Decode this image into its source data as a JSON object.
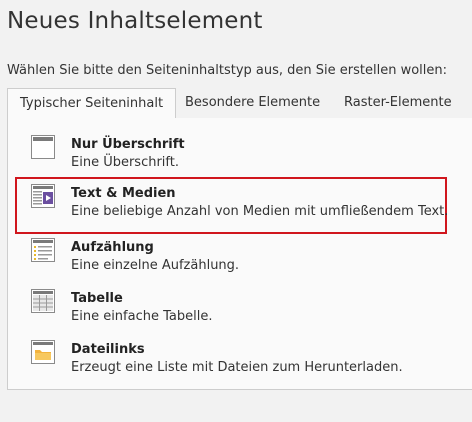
{
  "header": {
    "title": "Neues Inhaltselement",
    "instruction": "Wählen Sie bitte den Seiteninhaltstyp aus, den Sie erstellen wollen:"
  },
  "tabs": [
    {
      "label": "Typischer Seiteninhalt",
      "active": true
    },
    {
      "label": "Besondere Elemente",
      "active": false
    },
    {
      "label": "Raster-Elemente",
      "active": false
    }
  ],
  "items": [
    {
      "title": "Nur Überschrift",
      "description": "Eine Überschrift.",
      "icon": "header-only-icon",
      "selected": false
    },
    {
      "title": "Text & Medien",
      "description": "Eine beliebige Anzahl von Medien mit umfließendem Text.",
      "icon": "text-media-icon",
      "selected": true
    },
    {
      "title": "Aufzählung",
      "description": "Eine einzelne Aufzählung.",
      "icon": "bullet-list-icon",
      "selected": false
    },
    {
      "title": "Tabelle",
      "description": "Eine einfache Tabelle.",
      "icon": "table-icon",
      "selected": false
    },
    {
      "title": "Dateilinks",
      "description": "Erzeugt eine Liste mit Dateien zum Herunterladen.",
      "icon": "file-links-icon",
      "selected": false
    }
  ],
  "colors": {
    "selection_border": "#d0161d",
    "icon_frame": "#8a8a8a",
    "icon_fill": "#e8e8e8",
    "media_purple": "#6b4fa0",
    "bullet_yellow": "#e8b92b",
    "folder_orange": "#f3b33d"
  }
}
